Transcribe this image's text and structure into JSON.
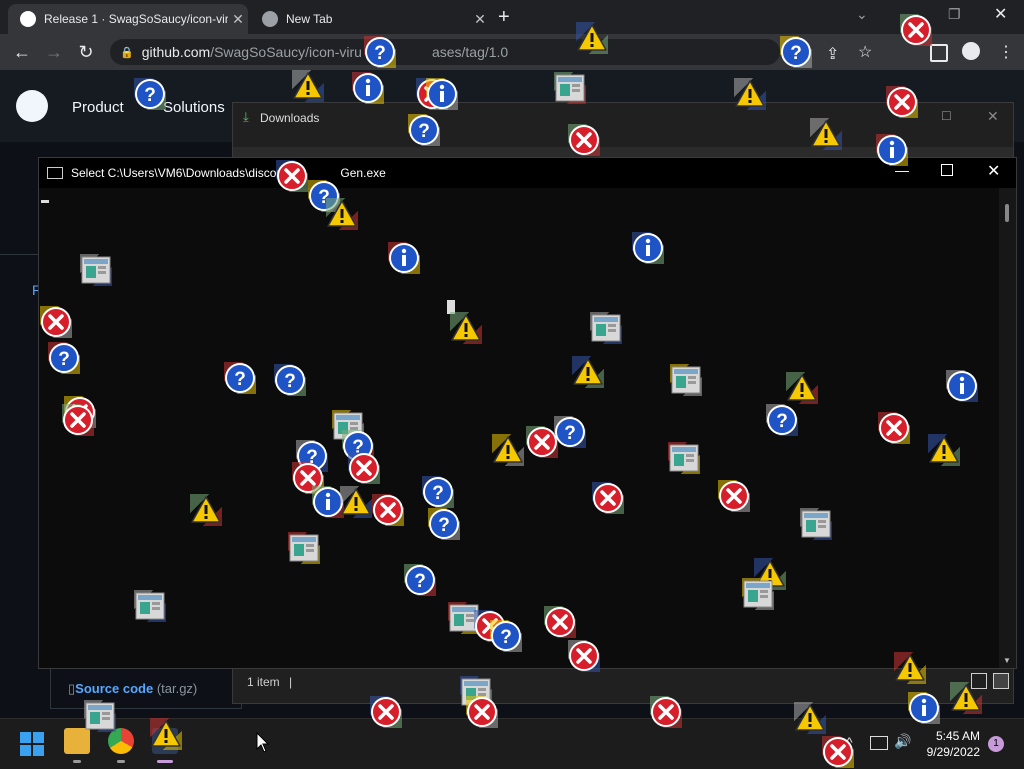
{
  "browser": {
    "tabs": [
      {
        "title": "Release 1 · SwagSoSaucy/icon-viru"
      },
      {
        "title": "New Tab"
      }
    ],
    "address_host": "github.com",
    "address_path": "/SwagSoSaucy/icon-viru",
    "address_path_tail": "ases/tag/1.0"
  },
  "github": {
    "nav": [
      "Product",
      "Solutions"
    ],
    "sidebar_letter": "R",
    "source_code_label": "Source code",
    "source_code_ext": "(tar.gz)"
  },
  "explorer": {
    "title": "Downloads",
    "status": "1 item"
  },
  "console": {
    "title_prefix": "Select C:\\Users\\VM6\\Downloads\\discor",
    "title_suffix": "Gen.exe"
  },
  "taskbar": {
    "time": "5:45 AM",
    "date": "9/29/2022",
    "notification_count": "1"
  },
  "colors": {
    "error": "#d61f2b",
    "info": "#1f54c6",
    "warning": "#f6c800",
    "chrome_bg": "#202124",
    "console_bg": "#0c0c0c"
  },
  "icon_kinds": [
    "error-icon",
    "info-icon",
    "question-icon",
    "warning-icon",
    "window-icon"
  ]
}
